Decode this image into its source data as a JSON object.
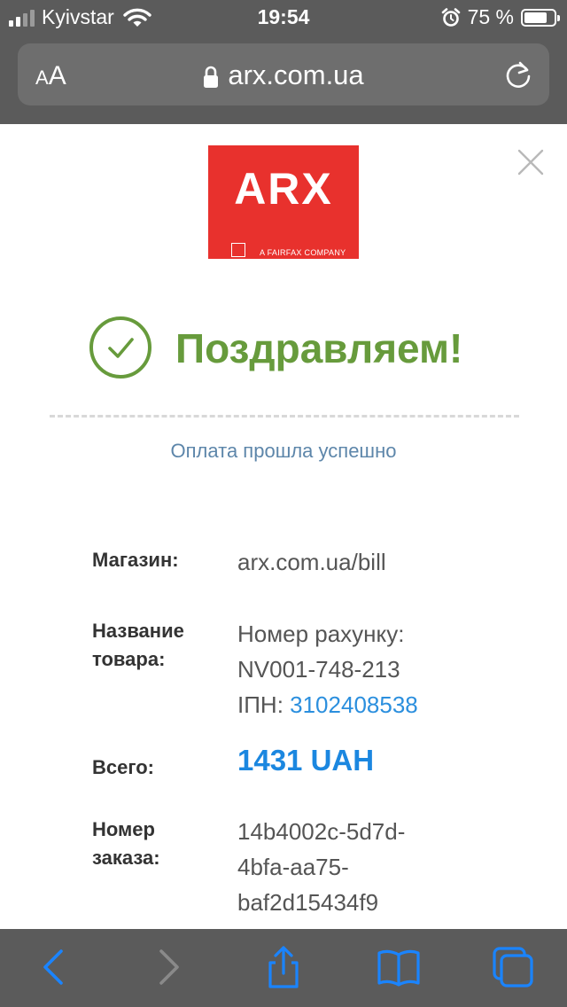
{
  "status_bar": {
    "carrier": "Kyivstar",
    "time": "19:54",
    "battery_percent": "75 %",
    "icons": [
      "signal-icon",
      "wifi-icon",
      "alarm-icon",
      "battery-icon"
    ]
  },
  "address_bar": {
    "text_size_small": "A",
    "text_size_large": "A",
    "url": "arx.com.ua",
    "icons": [
      "lock-icon",
      "reload-icon"
    ]
  },
  "page": {
    "logo": {
      "brand": "ARX",
      "tagline": "A FAIRFAX COMPANY"
    },
    "heading": "Поздравляем!",
    "subtitle": "Оплата прошла успешно",
    "details": {
      "shop_label": "Магазин:",
      "shop_value": "arx.com.ua/bill",
      "product_label_line1": "Название",
      "product_label_line2": "товара:",
      "product_line1": "Номер рахунку:",
      "product_line2": "NV001-748-213",
      "product_line3_prefix": "ІПН: ",
      "product_line3_link": "3102408538",
      "total_label": "Всего:",
      "total_value": "1431 UAH",
      "order_label_line1": "Номер",
      "order_label_line2": "заказа:",
      "order_line1": "14b4002c-5d7d-",
      "order_line2": "4bfa-aa75-",
      "order_line3": "baf2d15434f9"
    }
  },
  "toolbar": {
    "icons": [
      "back-icon",
      "forward-icon",
      "share-icon",
      "bookmarks-icon",
      "tabs-icon"
    ]
  },
  "colors": {
    "chrome": "#5b5b5b",
    "brand_red": "#e8312d",
    "success_green": "#679b3c",
    "link_blue": "#2b8fde",
    "toolbar_blue": "#1a84ff"
  }
}
